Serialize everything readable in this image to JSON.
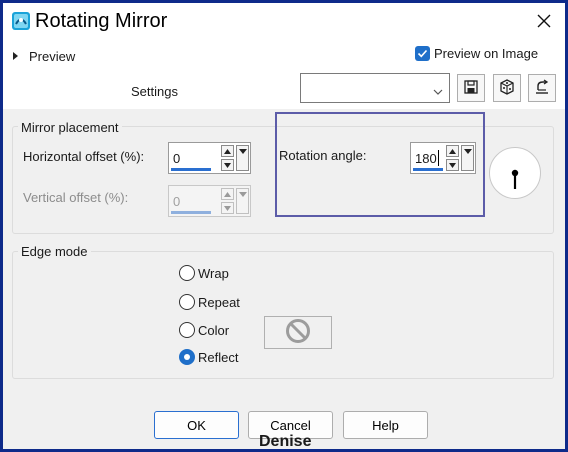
{
  "window": {
    "title": "Rotating Mirror",
    "accent_color": "#1f6fc9",
    "frame_color": "#0e2a8a"
  },
  "header": {
    "preview_label": "Preview",
    "preview_on_image": {
      "label": "Preview on Image",
      "checked": true
    },
    "settings_label": "Settings",
    "preset_value": ""
  },
  "mirror_placement": {
    "title": "Mirror placement",
    "horizontal_offset": {
      "label": "Horizontal offset (%):",
      "value": "0"
    },
    "vertical_offset": {
      "label": "Vertical offset (%):",
      "value": "0",
      "disabled": true
    },
    "rotation_angle": {
      "label": "Rotation angle:",
      "value": "180"
    }
  },
  "edge_mode": {
    "title": "Edge mode",
    "options": [
      {
        "label": "Wrap",
        "checked": false
      },
      {
        "label": "Repeat",
        "checked": false
      },
      {
        "label": "Color",
        "checked": false
      },
      {
        "label": "Reflect",
        "checked": true
      }
    ]
  },
  "buttons": {
    "ok": "OK",
    "cancel": "Cancel",
    "help": "Help"
  },
  "watermark": "Denise"
}
